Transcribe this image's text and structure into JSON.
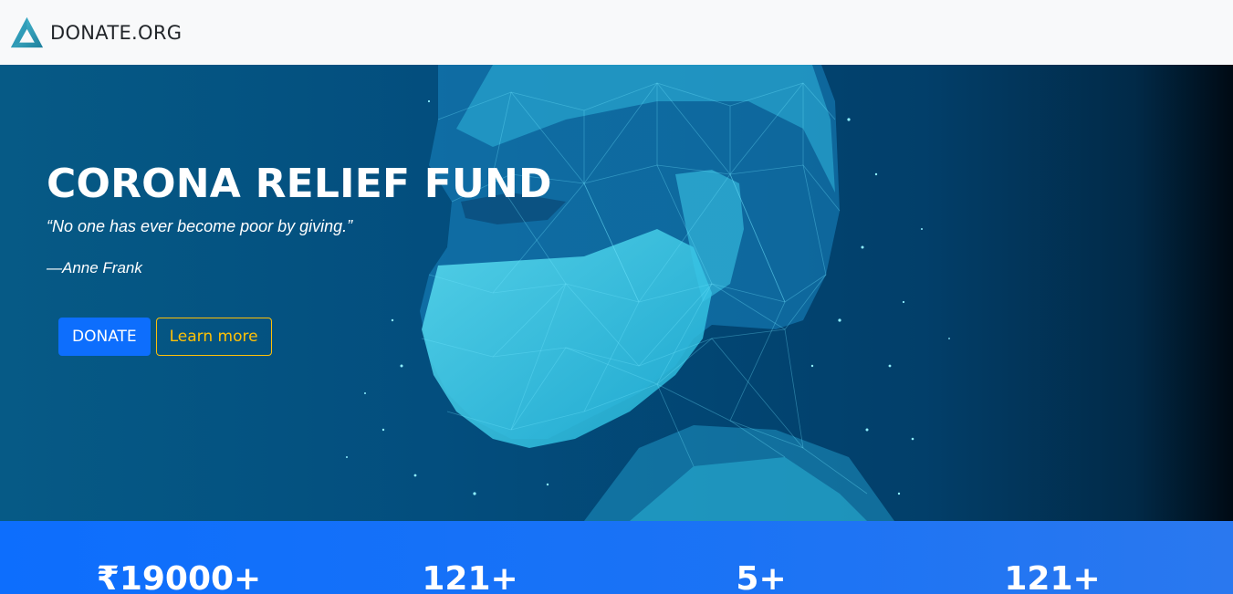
{
  "navbar": {
    "brand_text": "DONATE.ORG",
    "logo_icon": "triangle-logo-icon",
    "background": "#f8f9fa"
  },
  "hero": {
    "title": "CORONA RELIEF FUND",
    "quote": "“No one has ever become poor by giving.”",
    "author": "—Anne Frank",
    "illustration": "polygon-mesh-face-with-mask",
    "donate_label": "DONATE",
    "learn_more_label": "Learn more",
    "colors": {
      "background": "#034b78",
      "mesh": "#22c3e6",
      "donate_button": "#0d6efd",
      "learn_more_outline": "#ffc107"
    }
  },
  "stats": {
    "background": "#0d6efd",
    "items": [
      {
        "value": "₹19000+"
      },
      {
        "value": "121+"
      },
      {
        "value": "5+"
      },
      {
        "value": "121+"
      }
    ]
  }
}
